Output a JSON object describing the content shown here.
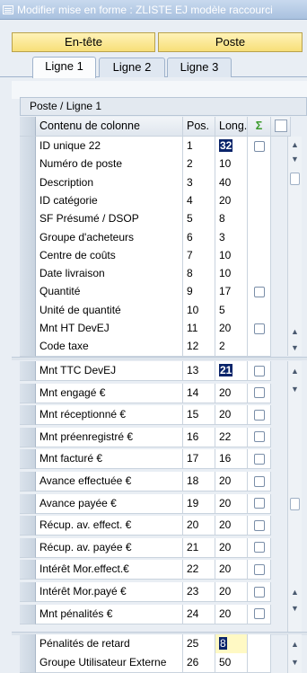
{
  "window": {
    "title": "Modifier mise en forme : ZLISTE EJ modèle raccourci"
  },
  "buttons": {
    "entete": "En-tête",
    "poste": "Poste"
  },
  "tabs": [
    {
      "label": "Ligne 1",
      "active": true
    },
    {
      "label": "Ligne 2",
      "active": false
    },
    {
      "label": "Ligne 3",
      "active": false
    }
  ],
  "section": {
    "title": "Poste / Ligne 1"
  },
  "columns": {
    "content": "Contenu de colonne",
    "pos": "Pos.",
    "len": "Long.",
    "sum_icon": "sigma-icon"
  },
  "table1": [
    {
      "name": "ID unique 22",
      "pos": "1",
      "len": "32",
      "sum": true,
      "highlight": true
    },
    {
      "name": "Numéro de poste",
      "pos": "2",
      "len": "10",
      "sum": false
    },
    {
      "name": "Description",
      "pos": "3",
      "len": "40",
      "sum": false
    },
    {
      "name": "ID catégorie",
      "pos": "4",
      "len": "20",
      "sum": false
    },
    {
      "name": "SF Présumé / DSOP",
      "pos": "5",
      "len": "8",
      "sum": false
    },
    {
      "name": "Groupe d'acheteurs",
      "pos": "6",
      "len": "3",
      "sum": false
    },
    {
      "name": "Centre de coûts",
      "pos": "7",
      "len": "10",
      "sum": false
    },
    {
      "name": "Date livraison",
      "pos": "8",
      "len": "10",
      "sum": false
    },
    {
      "name": "Quantité",
      "pos": "9",
      "len": "17",
      "sum": true
    },
    {
      "name": "Unité de quantité",
      "pos": "10",
      "len": "5",
      "sum": false
    },
    {
      "name": "Mnt HT DevEJ",
      "pos": "11",
      "len": "20",
      "sum": true
    },
    {
      "name": "Code taxe",
      "pos": "12",
      "len": "2",
      "sum": false
    }
  ],
  "table2": [
    {
      "name": "Mnt TTC DevEJ",
      "pos": "13",
      "len": "21",
      "sum": true,
      "highlight": true
    },
    {
      "name": "Mnt engagé €",
      "pos": "14",
      "len": "20",
      "sum": true
    },
    {
      "name": "Mnt réceptionné €",
      "pos": "15",
      "len": "20",
      "sum": true
    },
    {
      "name": "Mnt préenregistré €",
      "pos": "16",
      "len": "22",
      "sum": true
    },
    {
      "name": "Mnt facturé €",
      "pos": "17",
      "len": "16",
      "sum": true
    },
    {
      "name": "Avance effectuée €",
      "pos": "18",
      "len": "20",
      "sum": true
    },
    {
      "name": "Avance payée €",
      "pos": "19",
      "len": "20",
      "sum": true
    },
    {
      "name": "Récup. av. effect. €",
      "pos": "20",
      "len": "20",
      "sum": true
    },
    {
      "name": "Récup. av. payée €",
      "pos": "21",
      "len": "20",
      "sum": true
    },
    {
      "name": "Intérêt Mor.effect.€",
      "pos": "22",
      "len": "20",
      "sum": true
    },
    {
      "name": "Intérêt Mor.payé €",
      "pos": "23",
      "len": "20",
      "sum": true
    },
    {
      "name": "Mnt pénalités €",
      "pos": "24",
      "len": "20",
      "sum": true
    }
  ],
  "table3": [
    {
      "name": "Pénalités de retard",
      "pos": "25",
      "len": "8",
      "sum": false,
      "edit": true
    },
    {
      "name": "Groupe Utilisateur Externe",
      "pos": "26",
      "len": "50",
      "sum": false
    }
  ]
}
